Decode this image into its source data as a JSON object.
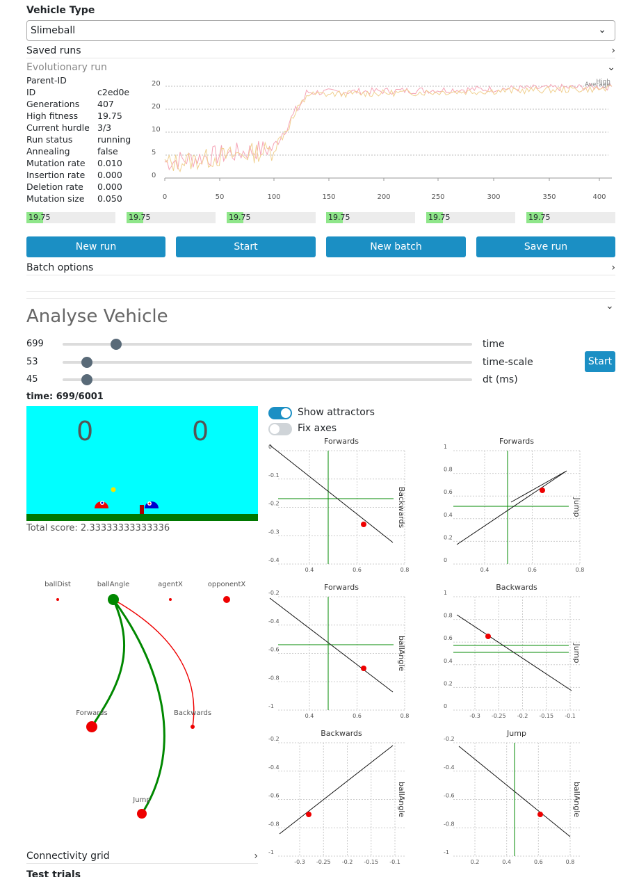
{
  "vehicle_type": {
    "label": "Vehicle Type",
    "value": "Slimeball"
  },
  "saved_runs": {
    "label": "Saved runs"
  },
  "evo": {
    "label": "Evolutionary run",
    "info": [
      {
        "k": "Parent-ID",
        "v": ""
      },
      {
        "k": "ID",
        "v": "c2ed0e"
      },
      {
        "k": "Generations",
        "v": "407"
      },
      {
        "k": "High fitness",
        "v": "19.75"
      },
      {
        "k": "Current hurdle",
        "v": "3/3"
      },
      {
        "k": "Run status",
        "v": "running"
      },
      {
        "k": "Annealing",
        "v": "false"
      },
      {
        "k": "Mutation rate",
        "v": "0.010"
      },
      {
        "k": "Insertion rate",
        "v": "0.000"
      },
      {
        "k": "Deletion rate",
        "v": "0.000"
      },
      {
        "k": "Mutation size",
        "v": "0.050"
      }
    ],
    "chart": {
      "y_ticks": [
        "20",
        "20",
        "10",
        "5",
        "0"
      ],
      "x_ticks": [
        "0",
        "50",
        "100",
        "150",
        "200",
        "250",
        "300",
        "350",
        "400"
      ],
      "legend": [
        "High",
        "Average"
      ]
    },
    "bars": [
      {
        "label": "19.75",
        "fraction": 0.19
      },
      {
        "label": "19.75",
        "fraction": 0.19
      },
      {
        "label": "19.75",
        "fraction": 0.19
      },
      {
        "label": "19.75",
        "fraction": 0.19
      },
      {
        "label": "19.75",
        "fraction": 0.19
      },
      {
        "label": "19.75",
        "fraction": 0.19
      }
    ],
    "buttons": {
      "new_run": "New run",
      "start": "Start",
      "new_batch": "New batch",
      "save_run": "Save run"
    },
    "batch_options": "Batch options"
  },
  "analyse": {
    "title": "Analyse Vehicle",
    "sliders": [
      {
        "value": "699",
        "label": "time",
        "level": 0.13
      },
      {
        "value": "53",
        "label": "time-scale",
        "level": 0.06
      },
      {
        "value": "45",
        "label": "dt (ms)",
        "level": 0.06
      }
    ],
    "start": "Start",
    "time_label": "time: 699/6001",
    "scores": [
      "0",
      "0"
    ],
    "total_score": "Total score: 2.33333333333336",
    "toggles": [
      {
        "label": "Show attractors",
        "on": true
      },
      {
        "label": "Fix axes",
        "on": false
      }
    ],
    "network": {
      "inputs": [
        "ballDist",
        "ballAngle",
        "agentX",
        "opponentX"
      ],
      "outputs": [
        "Forwards",
        "Backwards",
        "Jump"
      ]
    },
    "plots": [
      {
        "title": "Forwards",
        "ylabel": "Backwards",
        "x_ticks": [
          "0.4",
          "0.6",
          "0.8"
        ],
        "y_ticks": [
          "0",
          "-0.1",
          "-0.2",
          "-0.3",
          "-0.4"
        ]
      },
      {
        "title": "Forwards",
        "ylabel": "Jump",
        "x_ticks": [
          "0.4",
          "0.6",
          "0.8"
        ],
        "y_ticks": [
          "1",
          "0.8",
          "0.6",
          "0.4",
          "0.2",
          "0"
        ]
      },
      {
        "title": "Forwards",
        "ylabel": "ballAngle",
        "x_ticks": [
          "0.4",
          "0.6",
          "0.8"
        ],
        "y_ticks": [
          "-0.2",
          "-0.4",
          "-0.6",
          "-0.8",
          "-1"
        ]
      },
      {
        "title": "Backwards",
        "ylabel": "Jump",
        "x_ticks": [
          "-0.3",
          "-0.25",
          "-0.2",
          "-0.15",
          "-0.1"
        ],
        "y_ticks": [
          "1",
          "0.8",
          "0.6",
          "0.4",
          "0.2",
          "0"
        ]
      },
      {
        "title": "Backwards",
        "ylabel": "ballAngle",
        "x_ticks": [
          "-0.3",
          "-0.25",
          "-0.2",
          "-0.15",
          "-0.1"
        ],
        "y_ticks": [
          "-0.2",
          "-0.4",
          "-0.6",
          "-0.8",
          "-1"
        ]
      },
      {
        "title": "Jump",
        "ylabel": "ballAngle",
        "x_ticks": [
          "0.2",
          "0.4",
          "0.6",
          "0.8"
        ],
        "y_ticks": [
          "-0.2",
          "-0.4",
          "-0.6",
          "-0.8",
          "-1"
        ]
      }
    ],
    "connectivity_grid": "Connectivity grid",
    "test_trials": "Test trials"
  }
}
